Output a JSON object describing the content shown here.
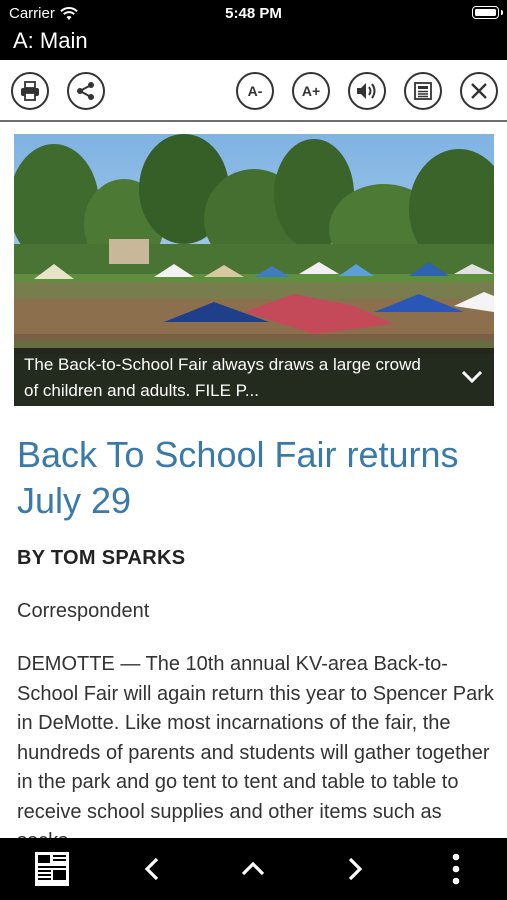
{
  "status_bar": {
    "carrier": "Carrier",
    "time": "5:48 PM"
  },
  "header": {
    "title": "A: Main"
  },
  "toolbar": {
    "print": "print-icon",
    "share": "share-icon",
    "font_smaller": "A-",
    "font_larger": "A+",
    "audio": "speaker-icon",
    "text_view": "article-text-icon",
    "close": "close-icon"
  },
  "article": {
    "caption": "The Back-to-School Fair always draws a large crowd of children and adults.  FILE P...",
    "headline": "Back To School Fair returns July 29",
    "byline": "BY TOM SPARKS",
    "role": "Correspondent",
    "body": "DEMOTTE — The 10th annual KV-area Back-to-School Fair will again return this year to Spencer Park in DeMotte. Like most incarnations of the fair, the hundreds of parents and students will gather together in the park and go tent to tent and table to table to receive school supplies and other items such as socks"
  },
  "bottom_bar": {
    "newspaper": "newspaper-icon",
    "prev": "chevron-left-icon",
    "up": "chevron-up-icon",
    "next": "chevron-right-icon",
    "more": "more-vertical-icon"
  },
  "colors": {
    "headline": "#3a7aa8",
    "bars": "#000000"
  }
}
